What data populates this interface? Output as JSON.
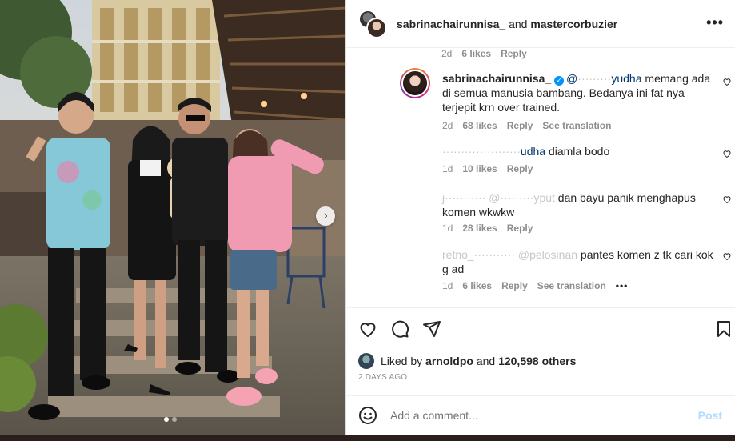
{
  "photo": {
    "alt_people": "four people standing on a wooden path",
    "next_icon": "chevron-right-icon",
    "carousel_total": 2,
    "carousel_active": 1
  },
  "header": {
    "user1": "sabrinachairunnisa_",
    "joiner": "and",
    "user2": "mastercorbuzier",
    "more_icon": "more-horizontal-icon"
  },
  "comments": {
    "top_meta": {
      "time": "2d",
      "likes": "6 likes",
      "reply": "Reply"
    },
    "items": [
      {
        "user": "sabrinachairunnisa_",
        "verified": true,
        "mention_visible": "@",
        "mention_faded": "·········",
        "mention_tail": "yudha",
        "text": " memang ada di semua manusia bambang. Bedanya ini fat nya terjepit krn over trained.",
        "time": "2d",
        "likes": "68 likes",
        "reply": "Reply",
        "translate": "See translation"
      },
      {
        "user_faded": "·····················",
        "mention_tail": "udha",
        "text": " diamla bodo",
        "time": "1d",
        "likes": "10 likes",
        "reply": "Reply"
      },
      {
        "user_faded": "j··········· @·········yput",
        "text": " dan bayu panik menghapus komen wkwkw",
        "time": "1d",
        "likes": "28 likes",
        "reply": "Reply"
      },
      {
        "user": "retno_",
        "user_faded": "··········· @pelosinan",
        "text": " pantes komen z tk cari kok g ad",
        "time": "1d",
        "likes": "6 likes",
        "reply": "Reply",
        "translate": "See translation",
        "more": "•••"
      }
    ]
  },
  "actions": {
    "like_icon": "heart-icon",
    "comment_icon": "comment-icon",
    "share_icon": "send-icon",
    "save_icon": "bookmark-icon"
  },
  "likes": {
    "prefix": "Liked by",
    "user": "arnoldpo",
    "joiner": "and",
    "count": "120,598 others"
  },
  "timeago": "2 DAYS AGO",
  "composer": {
    "placeholder": "Add a comment...",
    "post_label": "Post",
    "emoji_icon": "smiley-icon"
  },
  "colors": {
    "link": "#00376b",
    "verified": "#0095f6",
    "post_disabled": "#b3dbff",
    "muted": "#8e8e8e"
  }
}
